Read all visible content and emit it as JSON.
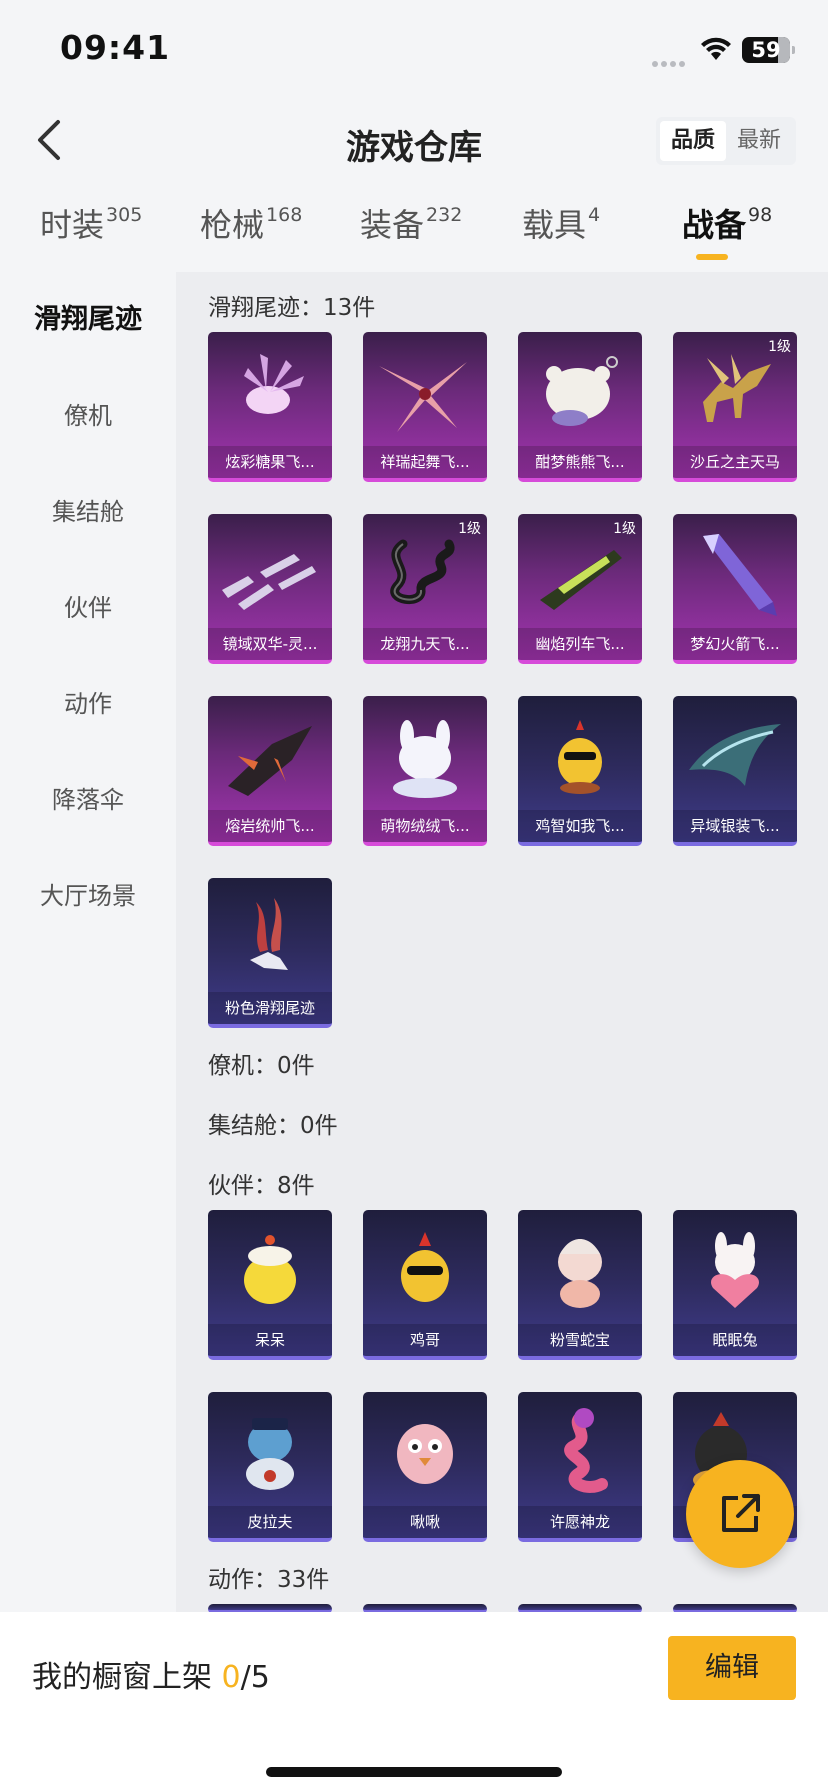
{
  "status_bar": {
    "time": "09:41",
    "battery": "59"
  },
  "header": {
    "title": "游戏仓库",
    "sort_options": [
      "品质",
      "最新"
    ],
    "sort_selected": "品质"
  },
  "tabs": [
    {
      "label": "时装",
      "count": "305"
    },
    {
      "label": "枪械",
      "count": "168"
    },
    {
      "label": "装备",
      "count": "232"
    },
    {
      "label": "载具",
      "count": "4"
    },
    {
      "label": "战备",
      "count": "98",
      "active": true
    }
  ],
  "sidebar": {
    "items": [
      "滑翔尾迹",
      "僚机",
      "集结舱",
      "伙伴",
      "动作",
      "降落伞",
      "大厅场景"
    ],
    "active": "滑翔尾迹"
  },
  "sections": {
    "glide_trails": {
      "title": "滑翔尾迹：13件",
      "items": [
        {
          "name": "炫彩糖果飞...",
          "tier": "purple",
          "icon": "candy-sparkle-icon"
        },
        {
          "name": "祥瑞起舞飞...",
          "tier": "purple",
          "icon": "ribbon-star-icon"
        },
        {
          "name": "酣梦熊熊飞...",
          "tier": "purple",
          "icon": "sleeping-bear-icon"
        },
        {
          "name": "沙丘之主天马",
          "tier": "purple",
          "icon": "pegasus-icon",
          "level": "1级"
        },
        {
          "name": "镜域双华-灵...",
          "tier": "purple",
          "icon": "crystal-blades-icon"
        },
        {
          "name": "龙翔九天飞...",
          "tier": "purple",
          "icon": "dragon-icon",
          "level": "1级"
        },
        {
          "name": "幽焰列车飞...",
          "tier": "purple",
          "icon": "flame-train-icon",
          "level": "1级"
        },
        {
          "name": "梦幻火箭飞...",
          "tier": "purple",
          "icon": "rocket-icon"
        },
        {
          "name": "熔岩统帅飞...",
          "tier": "purple",
          "icon": "lava-jet-icon"
        },
        {
          "name": "萌物绒绒飞...",
          "tier": "purple",
          "icon": "fluffy-bunny-icon"
        },
        {
          "name": "鸡智如我飞...",
          "tier": "blue",
          "icon": "chicken-icon"
        },
        {
          "name": "异域银装飞...",
          "tier": "blue",
          "icon": "silver-wing-icon"
        },
        {
          "name": "粉色滑翔尾迹",
          "tier": "blue",
          "icon": "pink-smoke-icon"
        }
      ]
    },
    "wingman": {
      "title": "僚机：0件"
    },
    "capsule": {
      "title": "集结舱：0件"
    },
    "partners": {
      "title": "伙伴：8件",
      "items": [
        {
          "name": "呆呆",
          "tier": "blue",
          "icon": "yellow-chick-icon"
        },
        {
          "name": "鸡哥",
          "tier": "blue",
          "icon": "cool-chicken-icon"
        },
        {
          "name": "粉雪蛇宝",
          "tier": "blue",
          "icon": "snake-baby-icon"
        },
        {
          "name": "眠眠兔",
          "tier": "blue",
          "icon": "bunny-heart-icon"
        },
        {
          "name": "皮拉夫",
          "tier": "blue",
          "icon": "blue-monster-icon"
        },
        {
          "name": "啾啾",
          "tier": "blue",
          "icon": "pink-bird-icon"
        },
        {
          "name": "许愿神龙",
          "tier": "blue",
          "icon": "wish-dragon-icon"
        },
        {
          "name": "",
          "tier": "blue",
          "icon": "helmet-chicken-icon"
        }
      ]
    },
    "actions": {
      "title": "动作：33件"
    }
  },
  "bottom": {
    "label": "我的橱窗上架",
    "used": "0",
    "total": "/5",
    "edit_label": "编辑"
  },
  "colors": {
    "accent": "#f7b320",
    "purple_tier": "#a334b0",
    "blue_tier": "#3f3b8a"
  }
}
